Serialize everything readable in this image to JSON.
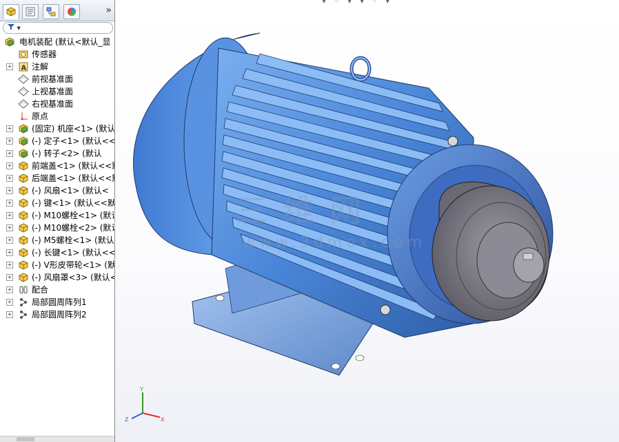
{
  "panel": {
    "tabs": [
      {
        "icon": "feature-manager-icon"
      },
      {
        "icon": "property-manager-icon"
      },
      {
        "icon": "configuration-manager-icon"
      },
      {
        "icon": "display-manager-icon"
      }
    ],
    "expand_glyph": "»",
    "filter_glyph": "▼"
  },
  "tree": {
    "root": "电机装配   (默认<默认_显",
    "items": [
      {
        "label": "传感器",
        "icon": "sensor-icon",
        "expandable": false
      },
      {
        "label": "注解",
        "icon": "annotation-icon",
        "expandable": true
      },
      {
        "label": "前视基准面",
        "icon": "plane-icon",
        "expandable": false
      },
      {
        "label": "上视基准面",
        "icon": "plane-icon",
        "expandable": false
      },
      {
        "label": "右视基准面",
        "icon": "plane-icon",
        "expandable": false
      },
      {
        "label": "原点",
        "icon": "origin-icon",
        "expandable": false
      },
      {
        "label": "(固定) 机座<1> (默认",
        "icon": "assembly-icon",
        "expandable": true
      },
      {
        "label": "(-) 定子<1> (默认<<",
        "icon": "assembly-icon",
        "expandable": true
      },
      {
        "label": "(-) 转子<2> (默认",
        "icon": "assembly-icon",
        "expandable": true
      },
      {
        "label": "前端盖<1> (默认<<默认",
        "icon": "part-icon",
        "expandable": true
      },
      {
        "label": "后端盖<1> (默认<<默认",
        "icon": "part-icon",
        "expandable": true
      },
      {
        "label": "(-) 风扇<1> (默认<",
        "icon": "part-icon",
        "expandable": true
      },
      {
        "label": "(-) 键<1> (默认<<默认",
        "icon": "part-icon",
        "expandable": true
      },
      {
        "label": "(-) M10螺栓<1> (默认",
        "icon": "part-icon",
        "expandable": true
      },
      {
        "label": "(-) M10螺栓<2> (默认",
        "icon": "part-icon",
        "expandable": true
      },
      {
        "label": "(-) M5螺栓<1> (默认<",
        "icon": "part-icon",
        "expandable": true
      },
      {
        "label": "(-) 长键<1> (默认<<",
        "icon": "part-icon",
        "expandable": true
      },
      {
        "label": "(-) V形皮带轮<1> (默认",
        "icon": "part-icon",
        "expandable": true
      },
      {
        "label": "(-) 风扇罩<3> (默认<",
        "icon": "part-icon",
        "expandable": true
      },
      {
        "label": "配合",
        "icon": "mates-icon",
        "expandable": true
      },
      {
        "label": "局部圆周阵列1",
        "icon": "pattern-icon",
        "expandable": true
      },
      {
        "label": "局部圆周阵列2",
        "icon": "pattern-icon",
        "expandable": true
      }
    ]
  },
  "viewport": {
    "model": "electric-motor-assembly",
    "watermark_cn": "三维网",
    "watermark_url": "www.3dmox.com",
    "triad": {
      "x": "X",
      "y": "Y",
      "z": "Z"
    }
  },
  "colors": {
    "motor_blue": "#4a86d8",
    "pulley_gray": "#7c7a84",
    "panel_border": "#8a8a8a"
  }
}
